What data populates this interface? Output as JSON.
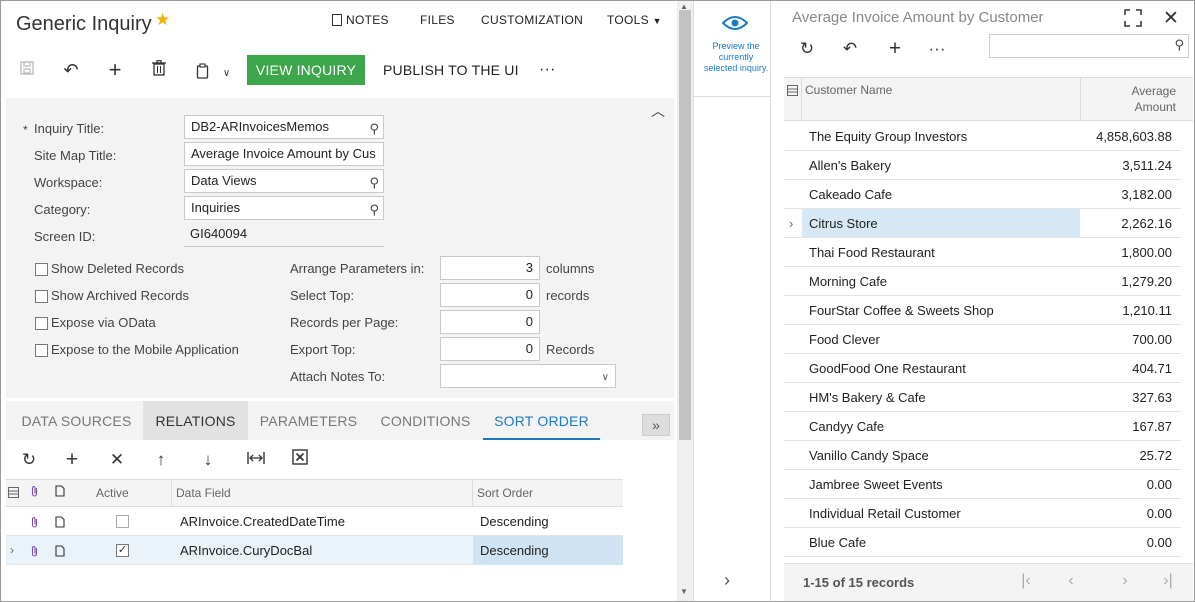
{
  "header": {
    "title": "Generic Inquiry",
    "links": [
      "NOTES",
      "FILES",
      "CUSTOMIZATION",
      "TOOLS"
    ]
  },
  "toolbar": {
    "view_inquiry": "VIEW INQUIRY",
    "publish": "PUBLISH TO THE UI",
    "more": "···"
  },
  "form": {
    "labels": {
      "inquiry_title": "Inquiry Title:",
      "site_map_title": "Site Map Title:",
      "workspace": "Workspace:",
      "category": "Category:",
      "screen_id": "Screen ID:"
    },
    "values": {
      "inquiry_title": "DB2-ARInvoicesMemos",
      "site_map_title": "Average Invoice Amount by Cus",
      "workspace": "Data Views",
      "category": "Inquiries",
      "screen_id": "GI640094"
    },
    "checkboxes": [
      "Show Deleted Records",
      "Show Archived Records",
      "Expose via OData",
      "Expose to the Mobile Application"
    ],
    "params": [
      {
        "label": "Arrange Parameters in:",
        "value": "3",
        "unit": "columns"
      },
      {
        "label": "Select Top:",
        "value": "0",
        "unit": "records"
      },
      {
        "label": "Records per Page:",
        "value": "0",
        "unit": ""
      },
      {
        "label": "Export Top:",
        "value": "0",
        "unit": "Records"
      },
      {
        "label": "Attach Notes To:",
        "value": "",
        "unit": ""
      }
    ]
  },
  "tabs": [
    "DATA SOURCES",
    "RELATIONS",
    "PARAMETERS",
    "CONDITIONS",
    "SORT ORDER"
  ],
  "sort_grid": {
    "headers": {
      "active": "Active",
      "data_field": "Data Field",
      "sort_order": "Sort Order"
    },
    "rows": [
      {
        "active": false,
        "field": "ARInvoice.CreatedDateTime",
        "order": "Descending"
      },
      {
        "active": true,
        "field": "ARInvoice.CuryDocBal",
        "order": "Descending"
      }
    ]
  },
  "preview": {
    "text": "Preview the currently selected inquiry."
  },
  "right": {
    "title": "Average Invoice Amount by Customer",
    "col_name": "Customer Name",
    "col_amount_1": "Average",
    "col_amount_2": "Amount",
    "rows": [
      {
        "name": "The Equity Group Investors",
        "amount": "4,858,603.88"
      },
      {
        "name": "Allen's Bakery",
        "amount": "3,511.24"
      },
      {
        "name": "Cakeado Cafe",
        "amount": "3,182.00"
      },
      {
        "name": "Citrus Store",
        "amount": "2,262.16"
      },
      {
        "name": "Thai Food Restaurant",
        "amount": "1,800.00"
      },
      {
        "name": "Morning Cafe",
        "amount": "1,279.20"
      },
      {
        "name": "FourStar Coffee & Sweets Shop",
        "amount": "1,210.11"
      },
      {
        "name": "Food Clever",
        "amount": "700.00"
      },
      {
        "name": "GoodFood One Restaurant",
        "amount": "404.71"
      },
      {
        "name": "HM's Bakery & Cafe",
        "amount": "327.63"
      },
      {
        "name": "Candyy Cafe",
        "amount": "167.87"
      },
      {
        "name": "Vanillo Candy Space",
        "amount": "25.72"
      },
      {
        "name": "Jambree Sweet Events",
        "amount": "0.00"
      },
      {
        "name": "Individual Retail Customer",
        "amount": "0.00"
      },
      {
        "name": "Blue Cafe",
        "amount": "0.00"
      }
    ],
    "footer": "1-15 of 15 records"
  },
  "colors": {
    "accent": "#1a7bc4",
    "green": "#3ba64a",
    "selected_row": "#d6e8f5",
    "star": "#f0b400"
  }
}
